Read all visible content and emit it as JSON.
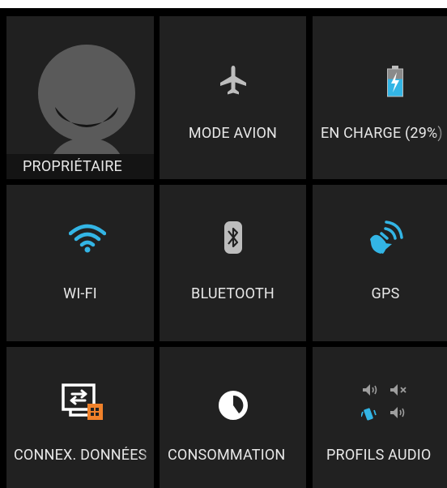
{
  "tiles": {
    "owner": {
      "label": "PROPRIÉTAIRE",
      "icon": "user-avatar-icon"
    },
    "airplane": {
      "label": "MODE AVION",
      "icon": "airplane-icon"
    },
    "battery": {
      "label": "EN CHARGE (29%)",
      "icon": "battery-charging-icon"
    },
    "wifi": {
      "label": "WI-FI",
      "icon": "wifi-icon",
      "state": "on"
    },
    "bluetooth": {
      "label": "BLUETOOTH",
      "icon": "bluetooth-icon",
      "state": "off"
    },
    "gps": {
      "label": "GPS",
      "icon": "gps-satellite-icon",
      "state": "on"
    },
    "data": {
      "label": "CONNEX. DONNÉES",
      "icon": "data-connection-icon"
    },
    "usage": {
      "label": "CONSOMMATION",
      "icon": "data-usage-icon"
    },
    "audio": {
      "label": "PROFILS AUDIO",
      "icon": "audio-profiles-icon"
    }
  },
  "colors": {
    "accent": "#33b5e5",
    "tile": "#212121",
    "grid": "#000000",
    "text": "#e8e8e8",
    "icon_muted": "#bdbdbd",
    "data_badge": "#f0812a"
  }
}
